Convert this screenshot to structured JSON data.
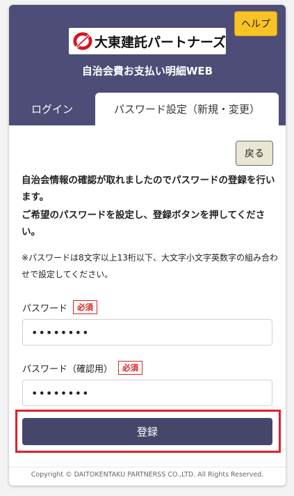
{
  "header": {
    "help_label": "ヘルプ",
    "logo_text": "大東建託パートナーズ",
    "site_title": "自治会費お支払い明細WEB"
  },
  "tabs": [
    {
      "label": "ログイン",
      "active": false
    },
    {
      "label": "パスワード設定（新規・変更）",
      "active": true
    }
  ],
  "main": {
    "back_label": "戻る",
    "message_line1": "自治会情報の確認が取れましたのでパスワードの登録を行います。",
    "message_line2": "ご希望のパスワードを設定し、登録ボタンを押してください。",
    "note": "※パスワードは8文字以上13桁以下、大文字小文字英数字の組み合わせで設定してください。",
    "password": {
      "label": "パスワード",
      "required": "必須",
      "value": "••••••••"
    },
    "password_confirm": {
      "label": "パスワード（確認用）",
      "required": "必須",
      "value": "••••••••"
    },
    "submit_label": "登録"
  },
  "footer": {
    "copyright": "Copyright © DAITOKENTAKU PARTNERSS CO.,LTD. All Rights Reserved."
  },
  "colors": {
    "header_bg": "#4d4d78",
    "help_bg": "#f7c325",
    "submit_bg": "#46466a",
    "required_red": "#d92020",
    "highlight_red": "#e0202a"
  }
}
